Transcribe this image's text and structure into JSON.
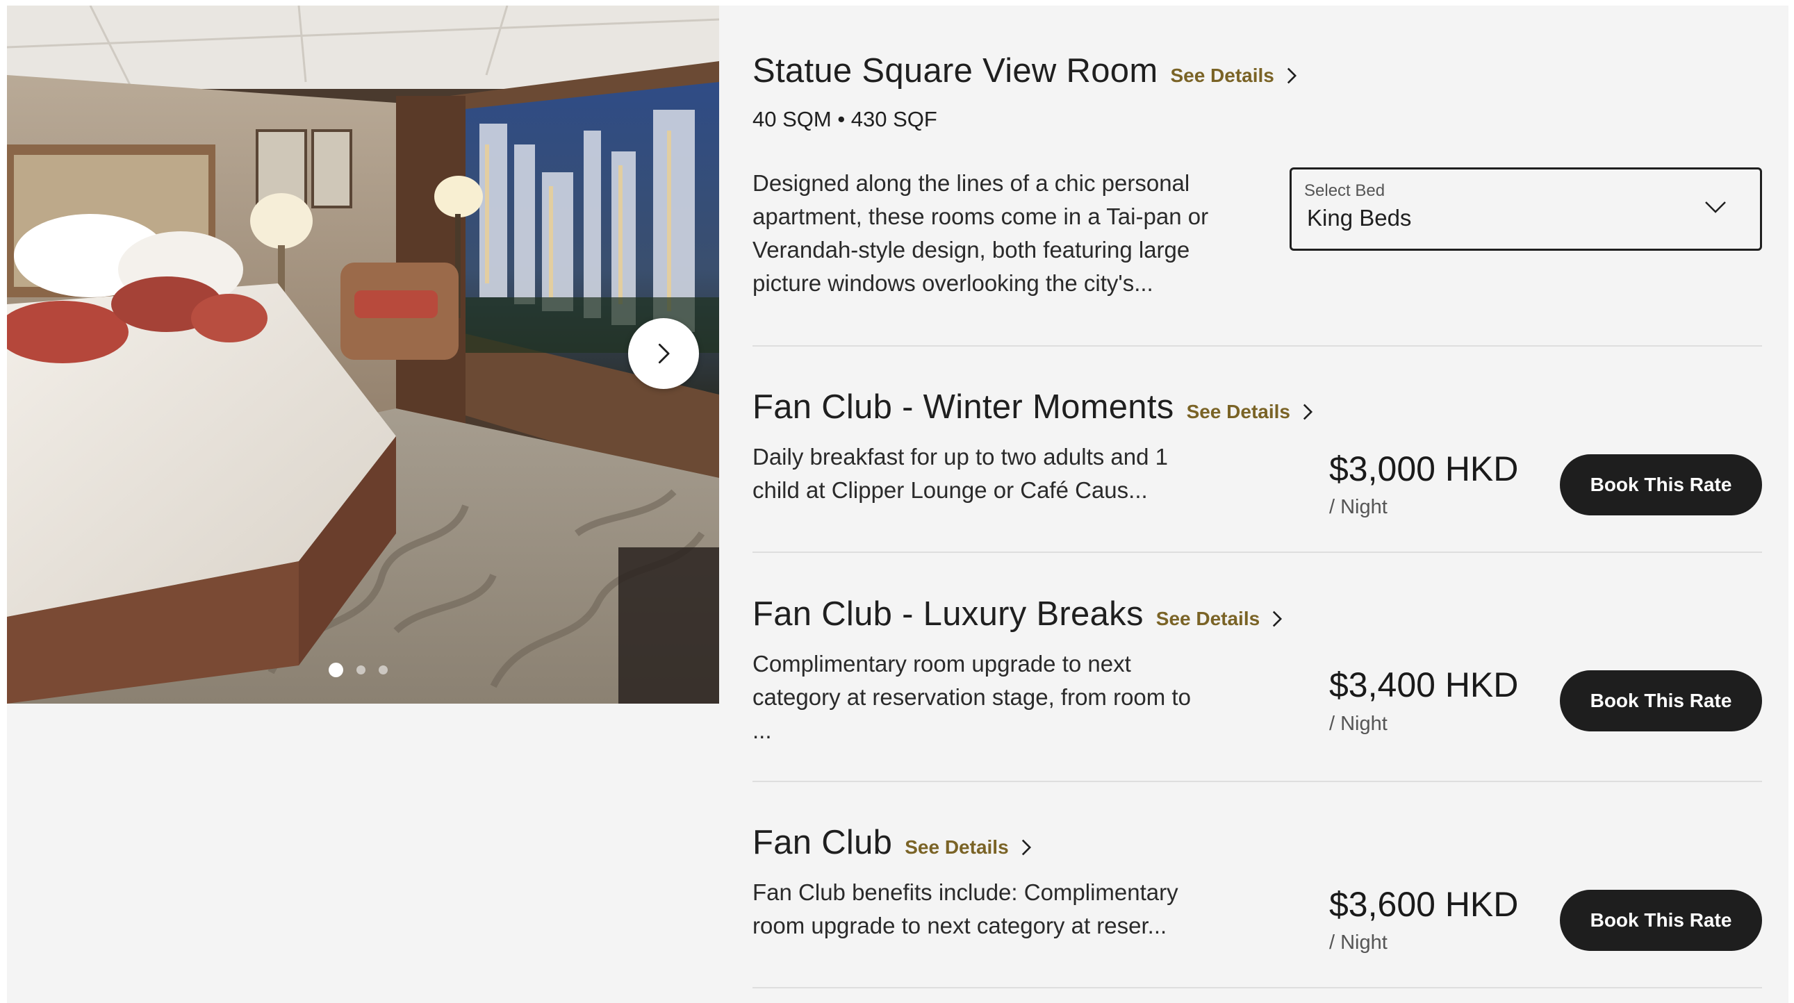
{
  "room": {
    "title": "Statue Square View Room",
    "see_details": "See Details",
    "size": "40 SQM • 430 SQF",
    "description": "Designed along the lines of a chic personal apartment, these rooms come in a Tai-pan or Verandah-style design, both featuring large picture windows overlooking the city's...",
    "bed_select": {
      "label": "Select Bed",
      "value": "King Beds"
    }
  },
  "gallery": {
    "slides": 3,
    "active_slide": 1
  },
  "icons": {
    "next": "chevron-right-icon",
    "dropdown": "chevron-down-icon",
    "details": "chevron-right-icon"
  },
  "colors": {
    "accent": "#7a6326",
    "button": "#1e1e1e",
    "background": "#f4f4f4"
  },
  "rates": [
    {
      "title": "Fan Club - Winter Moments",
      "see_details": "See Details",
      "description": "Daily breakfast for up to two adults and 1 child at Clipper Lounge or Café Caus...",
      "price": "$3,000 HKD",
      "per": "/ Night",
      "book": "Book This Rate"
    },
    {
      "title": "Fan Club - Luxury Breaks",
      "see_details": "See Details",
      "description": "Complimentary room upgrade to next category at reservation stage, from room to ...",
      "price": "$3,400 HKD",
      "per": "/ Night",
      "book": "Book This Rate"
    },
    {
      "title": "Fan Club",
      "see_details": "See Details",
      "description": "Fan Club benefits include: Complimentary room upgrade to next category at reser...",
      "price": "$3,600 HKD",
      "per": "/ Night",
      "book": "Book This Rate"
    }
  ]
}
